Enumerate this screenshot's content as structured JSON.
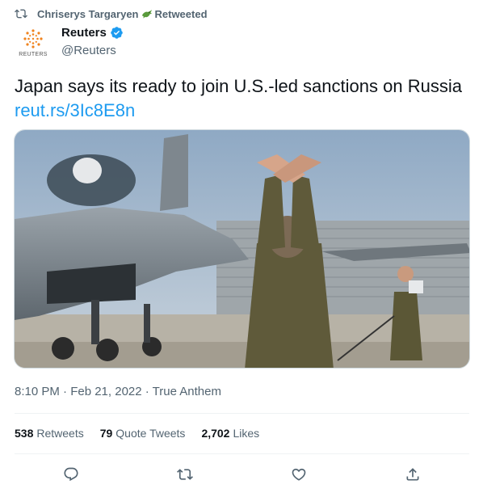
{
  "retweet": {
    "user": "Chriserys Targaryen",
    "emoji_icon": "crocodile-emoji",
    "label": "Retweeted"
  },
  "author": {
    "display_name": "Reuters",
    "handle": "@Reuters",
    "avatar_caption": "REUTERS",
    "verified": true
  },
  "tweet": {
    "text": "Japan says its ready to join U.S.-led sanctions on Russia ",
    "link": "reut.rs/3Ic8E8n"
  },
  "media": {
    "icon": "photo-fighter-jet-marshaller"
  },
  "meta": {
    "timestamp": "8:10 PM · Feb 21, 2022 · True Anthem"
  },
  "stats": {
    "retweets_count": "538",
    "retweets_label": "Retweets",
    "quotes_count": "79",
    "quotes_label": "Quote Tweets",
    "likes_count": "2,702",
    "likes_label": "Likes"
  },
  "actions": {
    "icons": [
      "reply-icon",
      "retweet-icon",
      "like-icon",
      "share-icon"
    ]
  },
  "colors": {
    "link": "#1d9bf0",
    "secondary_text": "#536471",
    "primary_text": "#0f1419",
    "verified": "#1d9bf0"
  }
}
